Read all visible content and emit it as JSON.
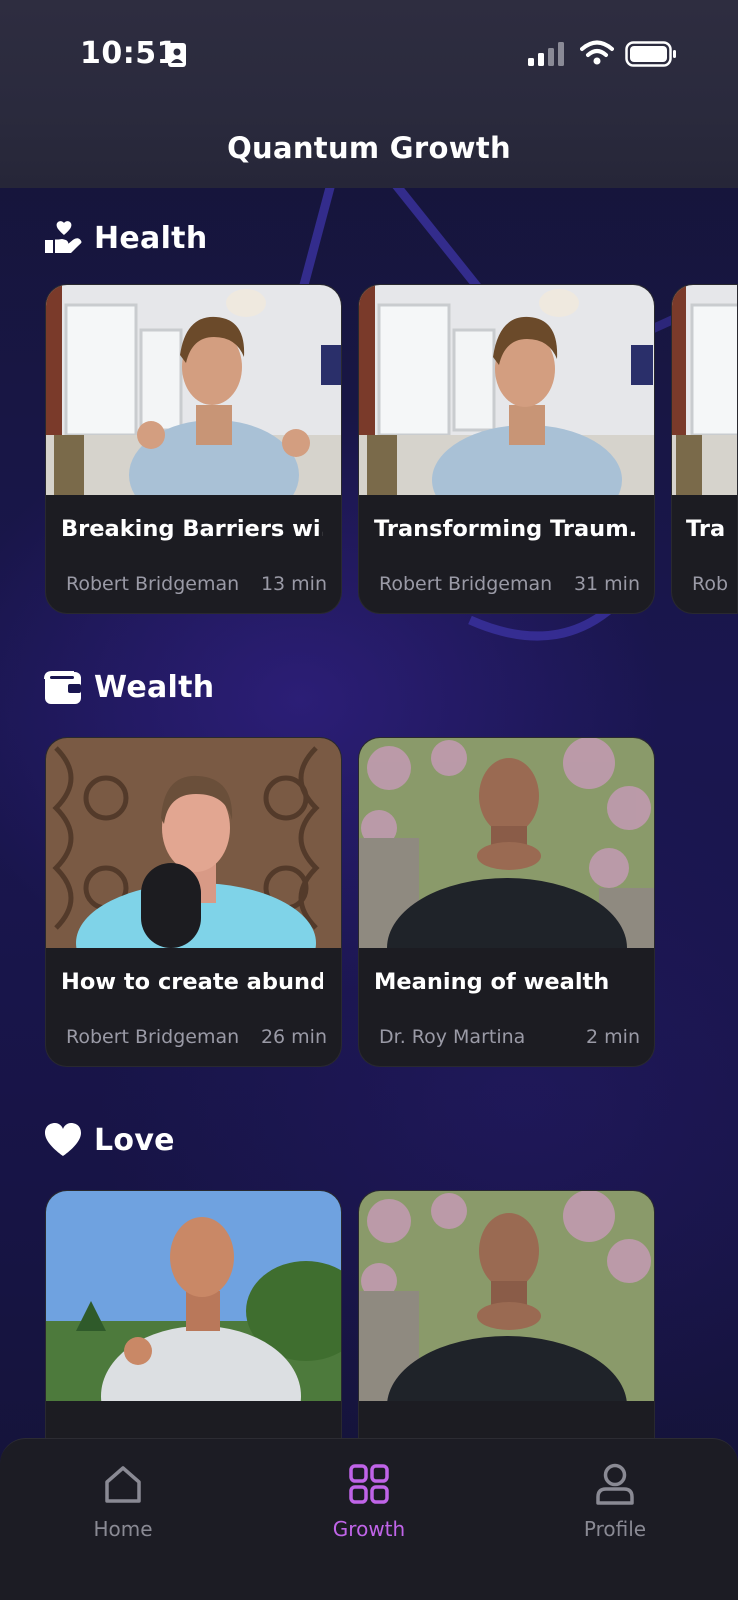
{
  "status_bar": {
    "time": "10:51"
  },
  "header": {
    "title": "Quantum Growth"
  },
  "sections": [
    {
      "label": "Health",
      "icon": "hand-heart-icon",
      "cards": [
        {
          "title": "Breaking Barriers wi...",
          "author": "Robert Bridgeman",
          "duration": "13 min"
        },
        {
          "title": "Transforming Traum...",
          "author": "Robert Bridgeman",
          "duration": "31 min"
        },
        {
          "title": "Tra",
          "author": "Rob",
          "duration": ""
        }
      ]
    },
    {
      "label": "Wealth",
      "icon": "wallet-icon",
      "cards": [
        {
          "title": "How to create abund...",
          "author": "Robert Bridgeman",
          "duration": "26 min"
        },
        {
          "title": "Meaning of wealth",
          "author": "Dr. Roy Martina",
          "duration": "2 min"
        }
      ]
    },
    {
      "label": "Love",
      "icon": "heart-icon",
      "cards": [
        {
          "title": "",
          "author": "",
          "duration": ""
        },
        {
          "title": "",
          "author": "",
          "duration": ""
        }
      ]
    }
  ],
  "bottom_nav": {
    "items": [
      {
        "label": "Home",
        "icon": "home-icon",
        "active": false
      },
      {
        "label": "Growth",
        "icon": "grid-icon",
        "active": true
      },
      {
        "label": "Profile",
        "icon": "user-icon",
        "active": false
      }
    ]
  },
  "colors": {
    "accent": "#c064e8",
    "background": "#1a1650",
    "card": "#1c1c22",
    "muted_text": "#9a9aa6"
  }
}
